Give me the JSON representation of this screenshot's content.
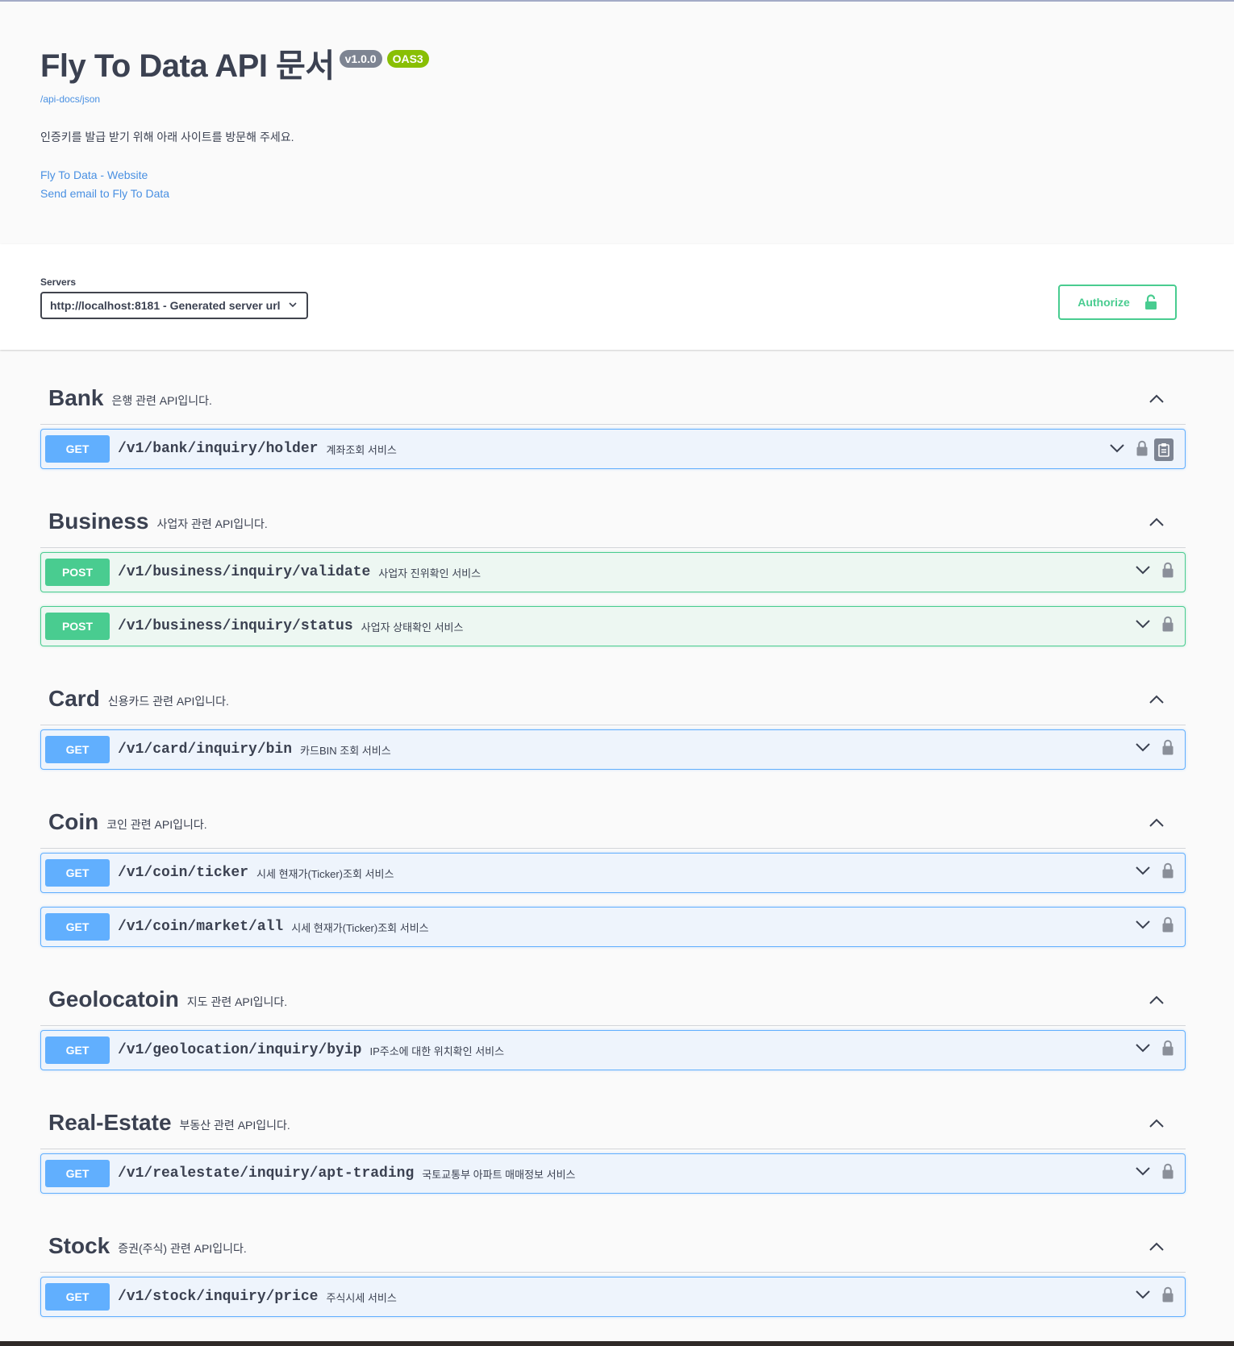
{
  "info": {
    "title": "Fly To Data API 문서",
    "version": "v1.0.0",
    "oas": "OAS3",
    "spec_url": "/api-docs/json",
    "description": "인증키를 발급 받기 위해 아래 사이트를 방문해 주세요.",
    "links": [
      "Fly To Data - Website",
      "Send email to Fly To Data"
    ]
  },
  "servers": {
    "label": "Servers",
    "selected": "http://localhost:8181 - Generated server url"
  },
  "authorize_label": "Authorize",
  "colors": {
    "get": "#61affe",
    "post": "#49cc90",
    "link": "#4990e2"
  },
  "tags": [
    {
      "name": "Bank",
      "description": "은행 관련 API입니다.",
      "operations": [
        {
          "method": "GET",
          "path": "/v1/bank/inquiry/holder",
          "summary": "계좌조회 서비스"
        }
      ]
    },
    {
      "name": "Business",
      "description": "사업자 관련 API입니다.",
      "operations": [
        {
          "method": "POST",
          "path": "/v1/business/inquiry/validate",
          "summary": "사업자 진위확인 서비스"
        },
        {
          "method": "POST",
          "path": "/v1/business/inquiry/status",
          "summary": "사업자 상태확인 서비스"
        }
      ]
    },
    {
      "name": "Card",
      "description": "신용카드 관련 API입니다.",
      "operations": [
        {
          "method": "GET",
          "path": "/v1/card/inquiry/bin",
          "summary": "카드BIN 조회 서비스"
        }
      ]
    },
    {
      "name": "Coin",
      "description": "코인 관련 API입니다.",
      "operations": [
        {
          "method": "GET",
          "path": "/v1/coin/ticker",
          "summary": "시세 현재가(Ticker)조회 서비스"
        },
        {
          "method": "GET",
          "path": "/v1/coin/market/all",
          "summary": "시세 현재가(Ticker)조회 서비스"
        }
      ]
    },
    {
      "name": "Geolocatoin",
      "description": "지도 관련 API입니다.",
      "operations": [
        {
          "method": "GET",
          "path": "/v1/geolocation/inquiry/byip",
          "summary": "IP주소에 대한 위치확인 서비스"
        }
      ]
    },
    {
      "name": "Real-Estate",
      "description": "부동산 관련 API입니다.",
      "operations": [
        {
          "method": "GET",
          "path": "/v1/realestate/inquiry/apt-trading",
          "summary": "국토교통부 아파트 매매정보 서비스"
        }
      ]
    },
    {
      "name": "Stock",
      "description": "증권(주식) 관련 API입니다.",
      "operations": [
        {
          "method": "GET",
          "path": "/v1/stock/inquiry/price",
          "summary": "주식시세 서비스"
        }
      ]
    }
  ]
}
